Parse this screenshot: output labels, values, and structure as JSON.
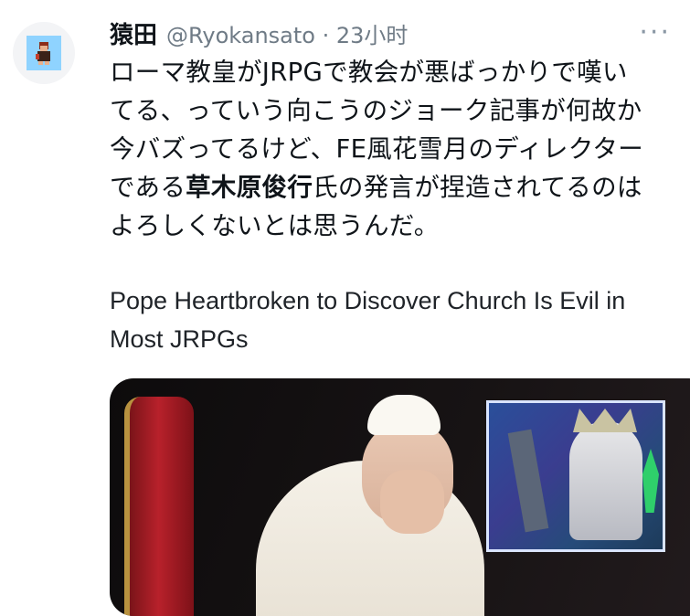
{
  "tweet": {
    "author_name": "猿田",
    "handle": "@Ryokansato",
    "separator": "·",
    "time": "23小时",
    "more": "···",
    "text_before_bold": "ローマ教皇がJRPGで教会が悪ばっかりで嘆い\nてる、っていう向こうのジョーク記事が何故か\n今バズってるけど、FE風花雪月のディレクター\nである",
    "text_bold": "草木原俊行",
    "text_after_bold": "氏の発言が捏造されてるのは\nよろしくないとは思うんだ。"
  },
  "card": {
    "headline": "Pope Heartbroken to Discover Church Is Evil in Most JRPGs"
  }
}
